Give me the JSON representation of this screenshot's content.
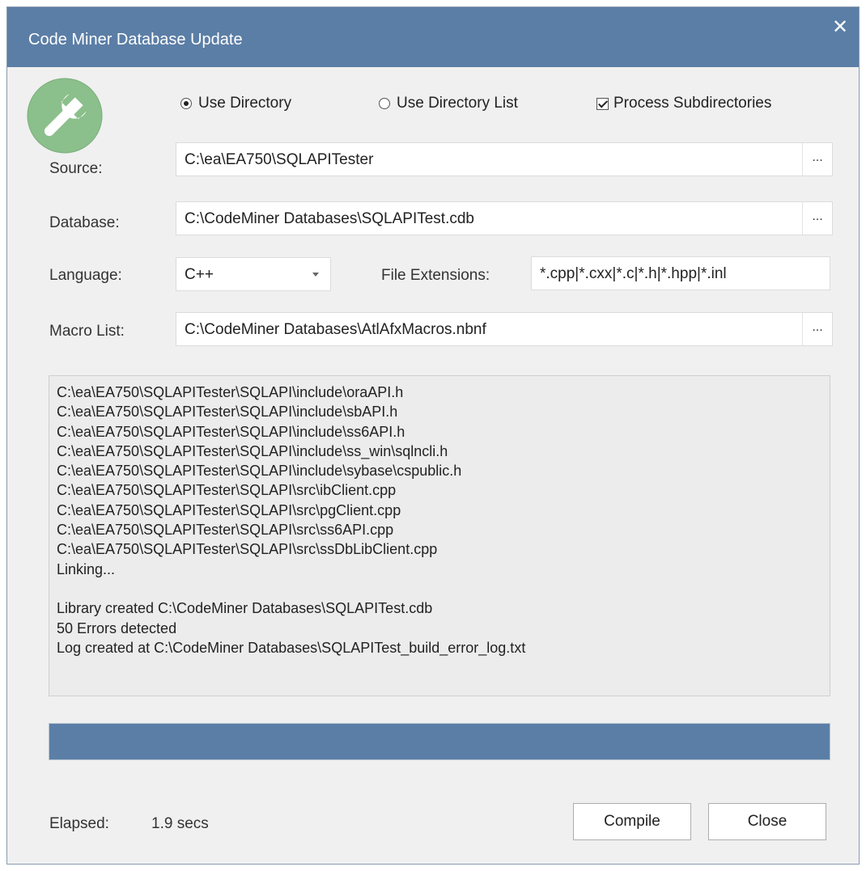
{
  "window": {
    "title": "Code Miner Database Update",
    "close_glyph": "✕"
  },
  "mode": {
    "use_directory": {
      "label": "Use Directory",
      "checked": true
    },
    "use_directory_list": {
      "label": "Use Directory List",
      "checked": false
    },
    "process_subdirectories": {
      "label": "Process Subdirectories",
      "checked": true
    }
  },
  "source": {
    "label": "Source:",
    "value": "C:\\ea\\EA750\\SQLAPITester",
    "browse": "..."
  },
  "database": {
    "label": "Database:",
    "value": "C:\\CodeMiner Databases\\SQLAPITest.cdb",
    "browse": "..."
  },
  "language": {
    "label": "Language:",
    "value": "C++"
  },
  "file_extensions": {
    "label": "File Extensions:",
    "value": "*.cpp|*.cxx|*.c|*.h|*.hpp|*.inl"
  },
  "macro_list": {
    "label": "Macro List:",
    "value": "C:\\CodeMiner Databases\\AtlAfxMacros.nbnf",
    "browse": "..."
  },
  "log_lines": [
    "C:\\ea\\EA750\\SQLAPITester\\SQLAPI\\include\\oraAPI.h",
    "C:\\ea\\EA750\\SQLAPITester\\SQLAPI\\include\\sbAPI.h",
    "C:\\ea\\EA750\\SQLAPITester\\SQLAPI\\include\\ss6API.h",
    "C:\\ea\\EA750\\SQLAPITester\\SQLAPI\\include\\ss_win\\sqlncli.h",
    "C:\\ea\\EA750\\SQLAPITester\\SQLAPI\\include\\sybase\\cspublic.h",
    "C:\\ea\\EA750\\SQLAPITester\\SQLAPI\\src\\ibClient.cpp",
    "C:\\ea\\EA750\\SQLAPITester\\SQLAPI\\src\\pgClient.cpp",
    "C:\\ea\\EA750\\SQLAPITester\\SQLAPI\\src\\ss6API.cpp",
    "C:\\ea\\EA750\\SQLAPITester\\SQLAPI\\src\\ssDbLibClient.cpp",
    "Linking...",
    "",
    "Library created C:\\CodeMiner Databases\\SQLAPITest.cdb",
    "50 Errors detected",
    "Log created at C:\\CodeMiner Databases\\SQLAPITest_build_error_log.txt"
  ],
  "progress": {
    "fraction": 1.0,
    "fill_color": "#5b7ea6"
  },
  "elapsed": {
    "label": "Elapsed:",
    "value": "1.9 secs"
  },
  "buttons": {
    "compile": "Compile",
    "close": "Close"
  },
  "colors": {
    "titlebar": "#5b7ea6",
    "logo": "#8bbf8b"
  },
  "icons": {
    "logo": "wrench-icon",
    "close": "close-icon",
    "dropdown": "chevron-down-icon"
  }
}
